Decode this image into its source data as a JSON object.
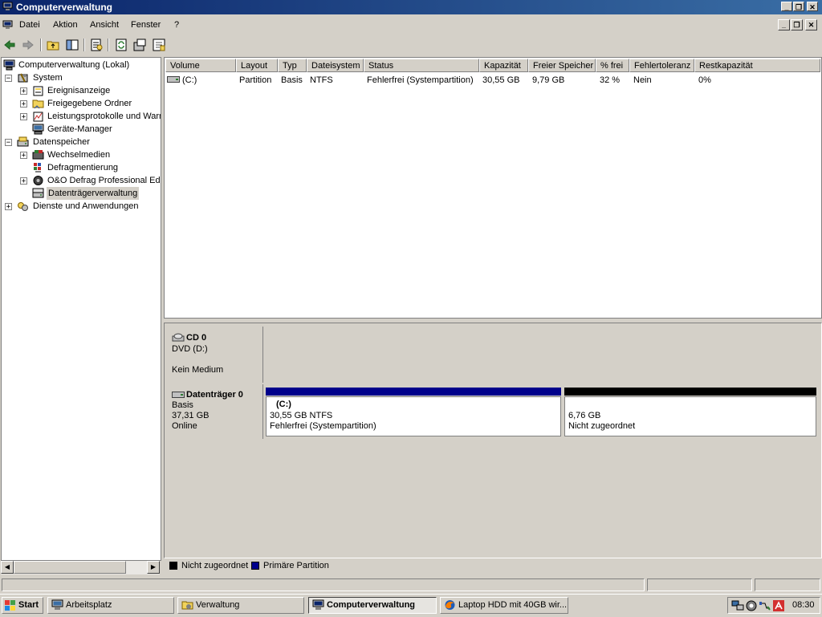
{
  "window": {
    "title": "Computerverwaltung"
  },
  "menu": {
    "items": [
      "Datei",
      "Aktion",
      "Ansicht",
      "Fenster",
      "?"
    ]
  },
  "tree": {
    "root": "Computerverwaltung (Lokal)",
    "system": "System",
    "system_children": [
      "Ereignisanzeige",
      "Freigegebene Ordner",
      "Leistungsprotokolle und Warn",
      "Geräte-Manager"
    ],
    "storage": "Datenspeicher",
    "storage_children": [
      "Wechselmedien",
      "Defragmentierung",
      "O&O Defrag Professional Edi",
      "Datenträgerverwaltung"
    ],
    "services": "Dienste und Anwendungen"
  },
  "volumes": {
    "columns": [
      "Volume",
      "Layout",
      "Typ",
      "Dateisystem",
      "Status",
      "Kapazität",
      "Freier Speicher",
      "% frei",
      "Fehlertoleranz",
      "Restkapazität"
    ],
    "rows": [
      [
        "(C:)",
        "Partition",
        "Basis",
        "NTFS",
        "Fehlerfrei (Systempartition)",
        "30,55 GB",
        "9,79 GB",
        "32 %",
        "Nein",
        "0%"
      ]
    ]
  },
  "disks": {
    "cd0": {
      "name": "CD 0",
      "drive": "DVD (D:)",
      "media": "Kein Medium"
    },
    "disk0": {
      "name": "Datenträger 0",
      "type": "Basis",
      "size": "37,31 GB",
      "state": "Online",
      "partitions": [
        {
          "label": "(C:)",
          "size": "30,55 GB NTFS",
          "status": "Fehlerfrei (Systempartition)"
        },
        {
          "label": "",
          "size": "6,76 GB",
          "status": "Nicht zugeordnet"
        }
      ]
    }
  },
  "legend": {
    "unallocated": "Nicht zugeordnet",
    "primary": "Primäre Partition"
  },
  "colors": {
    "primary": "#00008b",
    "unallocated": "#000000",
    "titlebar_start": "#0a246a",
    "titlebar_end": "#3a6ea5",
    "face": "#d4d0c8"
  },
  "taskbar": {
    "start": "Start",
    "tasks": [
      "Arbeitsplatz",
      "Verwaltung",
      "Computerverwaltung",
      "Laptop HDD mit 40GB wir..."
    ],
    "clock": "08:30"
  }
}
